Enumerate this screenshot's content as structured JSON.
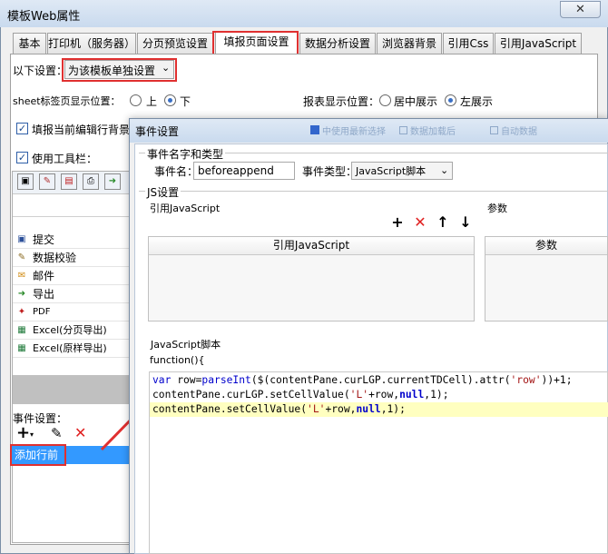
{
  "window": {
    "title": "模板Web属性",
    "close": "✕"
  },
  "tabs": [
    "基本",
    "打印机（服务器）",
    "分页预览设置",
    "填报页面设置",
    "数据分析设置",
    "浏览器背景",
    "引用Css",
    "引用JavaScript"
  ],
  "active_tab": "填报页面设置",
  "settings": {
    "label": "以下设置：",
    "select_value": "为该模板单独设置",
    "sheet_label": "sheet标签页显示位置：",
    "sheet_up": "上",
    "sheet_down": "下",
    "report_label": "报表显示位置：",
    "report_center": "居中展示",
    "report_left": "左展示",
    "fill_checkbox": "填报当前编辑行背景",
    "toolbar_checkbox": "使用工具栏："
  },
  "toolbar_items": [
    {
      "label": "提交",
      "icon": "submit-icon"
    },
    {
      "label": "数据校验",
      "icon": "validate-icon"
    },
    {
      "label": "邮件",
      "icon": "mail-icon"
    },
    {
      "label": "导出",
      "icon": "export-icon"
    },
    {
      "label": "PDF",
      "icon": "pdf-icon"
    },
    {
      "label": "Excel(分页导出)",
      "icon": "excel-icon"
    },
    {
      "label": "Excel(原样导出)",
      "icon": "excel-icon"
    }
  ],
  "events": {
    "label": "事件设置：",
    "selected": "添加行前"
  },
  "dialog": {
    "title": "事件设置",
    "bg_hint_1": "中使用最新选择",
    "bg_hint_2": "数据加载后",
    "bg_hint_3": "自动数据",
    "group_name_type": "事件名字和类型",
    "event_name_label": "事件名：",
    "event_name_value": "beforeappend",
    "event_type_label": "事件类型：",
    "event_type_value": "JavaScript脚本",
    "js_group": "JS设置",
    "ref_js_label": "引用JavaScript",
    "params_label": "参数",
    "ref_js_header": "引用JavaScript",
    "params_header": "参数",
    "script_label": "JavaScript脚本",
    "function_sig": "function(){",
    "code": {
      "l1": {
        "kw": "var",
        "a": " row=",
        "fn": "parseInt",
        "b": "($(contentPane.curLGP.currentTDCell).attr(",
        "s": "'row'",
        "c": "))+1;"
      },
      "l2": {
        "a": "contentPane.curLGP.setCellValue(",
        "s": "'L'",
        "b": "+row,",
        "kw": "null",
        "c": ",1);"
      },
      "l3": {
        "a": "contentPane.setCellValue(",
        "s": "'L'",
        "b": "+row,",
        "kw": "null",
        "c": ",1);"
      }
    }
  },
  "colors": {
    "highlight": "#e03030",
    "selection": "#3399ff",
    "code_highlight": "#ffffc0"
  }
}
